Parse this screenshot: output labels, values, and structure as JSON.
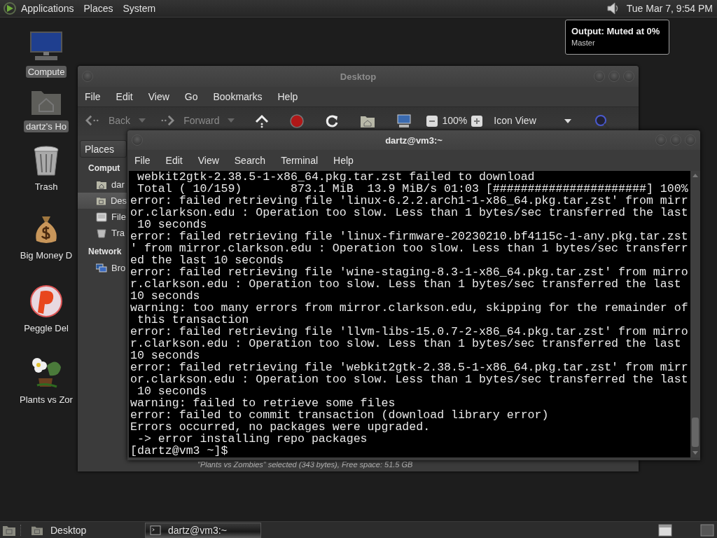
{
  "top_panel": {
    "menus": [
      "Applications",
      "Places",
      "System"
    ],
    "clock": "Tue Mar 7, 9:54 PM"
  },
  "tooltip": {
    "title": "Output: Muted at 0%",
    "subtitle": "Master"
  },
  "desktop_icons": [
    {
      "label": "Compute",
      "kind": "computer",
      "selected": true
    },
    {
      "label": "dartz's Ho",
      "kind": "home",
      "selected": true
    },
    {
      "label": "Trash",
      "kind": "trash",
      "selected": false
    },
    {
      "label": "Big Money D",
      "kind": "moneybag",
      "selected": false
    },
    {
      "label": "Peggle Del",
      "kind": "ball",
      "selected": false
    },
    {
      "label": "Plants vs Zor",
      "kind": "plant",
      "selected": false
    }
  ],
  "file_manager": {
    "title": "Desktop",
    "menu": [
      "File",
      "Edit",
      "View",
      "Go",
      "Bookmarks",
      "Help"
    ],
    "toolbar": {
      "back": "Back",
      "forward": "Forward",
      "zoom": "100%",
      "view": "Icon View"
    },
    "sidebar": {
      "header": "Places",
      "sections": [
        {
          "title": "Comput",
          "items": [
            {
              "label": "dar",
              "kind": "home",
              "selected": false
            },
            {
              "label": "Des",
              "kind": "desktop",
              "selected": true
            },
            {
              "label": "File",
              "kind": "drive",
              "selected": false
            },
            {
              "label": "Tra",
              "kind": "trash",
              "selected": false
            }
          ]
        },
        {
          "title": "Network",
          "items": [
            {
              "label": "Bro",
              "kind": "network",
              "selected": false
            }
          ]
        }
      ]
    },
    "status": "\"Plants vs Zombies\" selected (343 bytes), Free space: 51.5 GB"
  },
  "terminal": {
    "title": "dartz@vm3:~",
    "menu": [
      "File",
      "Edit",
      "View",
      "Search",
      "Terminal",
      "Help"
    ],
    "lines": [
      " webkit2gtk-2.38.5-1-x86_64.pkg.tar.zst failed to download",
      " Total ( 10/159)       873.1 MiB  13.9 MiB/s 01:03 [######################] 100%",
      "error: failed retrieving file 'linux-6.2.2.arch1-1-x86_64.pkg.tar.zst' from mirr",
      "or.clarkson.edu : Operation too slow. Less than 1 bytes/sec transferred the last",
      " 10 seconds",
      "error: failed retrieving file 'linux-firmware-20230210.bf4115c-1-any.pkg.tar.zst",
      "' from mirror.clarkson.edu : Operation too slow. Less than 1 bytes/sec transferr",
      "ed the last 10 seconds",
      "error: failed retrieving file 'wine-staging-8.3-1-x86_64.pkg.tar.zst' from mirro",
      "r.clarkson.edu : Operation too slow. Less than 1 bytes/sec transferred the last",
      "10 seconds",
      "warning: too many errors from mirror.clarkson.edu, skipping for the remainder of",
      " this transaction",
      "error: failed retrieving file 'llvm-libs-15.0.7-2-x86_64.pkg.tar.zst' from mirro",
      "r.clarkson.edu : Operation too slow. Less than 1 bytes/sec transferred the last",
      "10 seconds",
      "error: failed retrieving file 'webkit2gtk-2.38.5-1-x86_64.pkg.tar.zst' from mirr",
      "or.clarkson.edu : Operation too slow. Less than 1 bytes/sec transferred the last",
      " 10 seconds",
      "warning: failed to retrieve some files",
      "error: failed to commit transaction (download library error)",
      "Errors occurred, no packages were upgraded.",
      " -> error installing repo packages",
      "[dartz@vm3 ~]$"
    ]
  },
  "taskbar": {
    "tasks": [
      {
        "label": "Desktop",
        "kind": "folder",
        "selected": false
      },
      {
        "label": "dartz@vm3:~",
        "kind": "terminal",
        "selected": true
      }
    ]
  }
}
